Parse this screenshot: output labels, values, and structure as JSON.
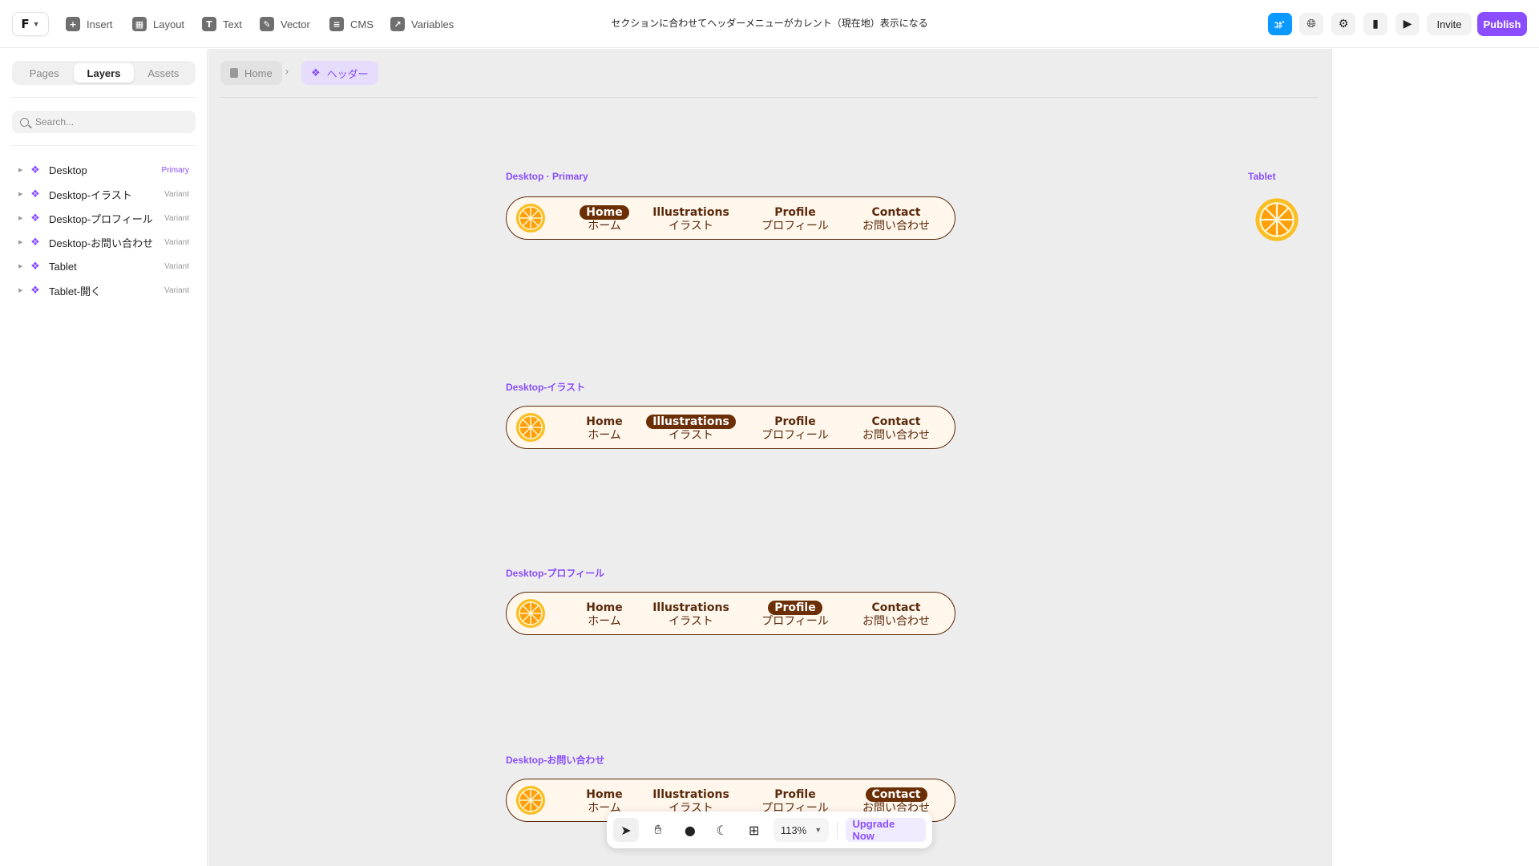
{
  "topbar": {
    "tools": [
      {
        "label": "Insert",
        "icon": "plus-icon",
        "glyph": "+"
      },
      {
        "label": "Layout",
        "icon": "layout-icon",
        "glyph": "▦"
      },
      {
        "label": "Text",
        "icon": "text-icon",
        "glyph": "T"
      },
      {
        "label": "Vector",
        "icon": "pen-icon",
        "glyph": "✎"
      },
      {
        "label": "CMS",
        "icon": "database-icon",
        "glyph": "≡"
      },
      {
        "label": "Variables",
        "icon": "variables-icon",
        "glyph": "↗"
      }
    ],
    "doc_title": "セクションに合わせてヘッダーメニューがカレント（現在地）表示になる",
    "avatar_label": "ｺﾎﾞ",
    "invite_label": "Invite",
    "publish_label": "Publish",
    "accent_color": "#8a4dff"
  },
  "sidebar": {
    "tabs": [
      "Pages",
      "Layers",
      "Assets"
    ],
    "active_tab": "Layers",
    "search_placeholder": "Search...",
    "layers": [
      {
        "name": "Desktop",
        "tag": "Primary"
      },
      {
        "name": "Desktop-イラスト",
        "tag": "Variant"
      },
      {
        "name": "Desktop-プロフィール",
        "tag": "Variant"
      },
      {
        "name": "Desktop-お問い合わせ",
        "tag": "Variant"
      },
      {
        "name": "Tablet",
        "tag": "Variant"
      },
      {
        "name": "Tablet-開く",
        "tag": "Variant"
      }
    ]
  },
  "canvas": {
    "breadcrumb": {
      "home": "Home",
      "component": "ヘッダー"
    },
    "frames": [
      {
        "label": "Desktop · Primary",
        "active": 0
      },
      {
        "label": "Desktop-イラスト",
        "active": 1
      },
      {
        "label": "Desktop-プロフィール",
        "active": 2
      },
      {
        "label": "Desktop-お問い合わせ",
        "active": 3
      }
    ],
    "tablet_label": "Tablet",
    "nav_items": [
      {
        "en": "Home",
        "ja": "ホーム"
      },
      {
        "en": "Illustrations",
        "ja": "イラスト"
      },
      {
        "en": "Profile",
        "ja": "プロフィール"
      },
      {
        "en": "Contact",
        "ja": "お問い合わせ"
      }
    ],
    "nav_colors": {
      "background": "#fff6ec",
      "text": "#5a2a0c",
      "active": "#6b2e05"
    }
  },
  "bottom_toolbar": {
    "zoom": "113%",
    "upgrade_label": "Upgrade Now"
  }
}
